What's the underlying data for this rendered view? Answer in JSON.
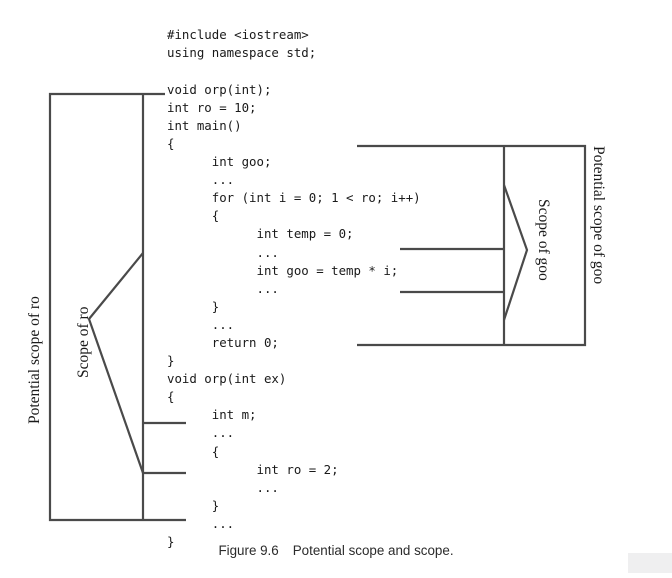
{
  "figure": {
    "caption_number": "Figure 9.6",
    "caption_text": "Potential scope and scope."
  },
  "code": {
    "lines": [
      "#include <iostream>",
      "using namespace std;",
      "",
      "void orp(int);",
      "int ro = 10;",
      "int main()",
      "{",
      "      int goo;",
      "      ...",
      "      for (int i = 0; 1 < ro; i++)",
      "      {",
      "            int temp = 0;",
      "            ...",
      "            int goo = temp * i;",
      "            ...",
      "      }",
      "      ...",
      "      return 0;",
      "}",
      "void orp(int ex)",
      "{",
      "      int m;",
      "      ...",
      "      {",
      "            int ro = 2;",
      "            ...",
      "      }",
      "      ...",
      "}"
    ],
    "full_text": "#include <iostream>\nusing namespace std;\n\nvoid orp(int);\nint ro = 10;\nint main()\n{\n      int goo;\n      ...\n      for (int i = 0; 1 < ro; i++)\n      {\n            int temp = 0;\n            ...\n            int goo = temp * i;\n            ...\n      }\n      ...\n      return 0;\n}\nvoid orp(int ex)\n{\n      int m;\n      ...\n      {\n            int ro = 2;\n            ...\n      }\n      ...\n}"
  },
  "labels": {
    "potential_scope_ro": "Potential scope of  ro",
    "scope_ro": "Scope of ro",
    "scope_goo": "Scope of goo",
    "potential_scope_goo": "Potential scope of goo"
  },
  "colors": {
    "line": "#4a4a4a",
    "text": "#1a1a1a",
    "background": "#ffffff"
  }
}
